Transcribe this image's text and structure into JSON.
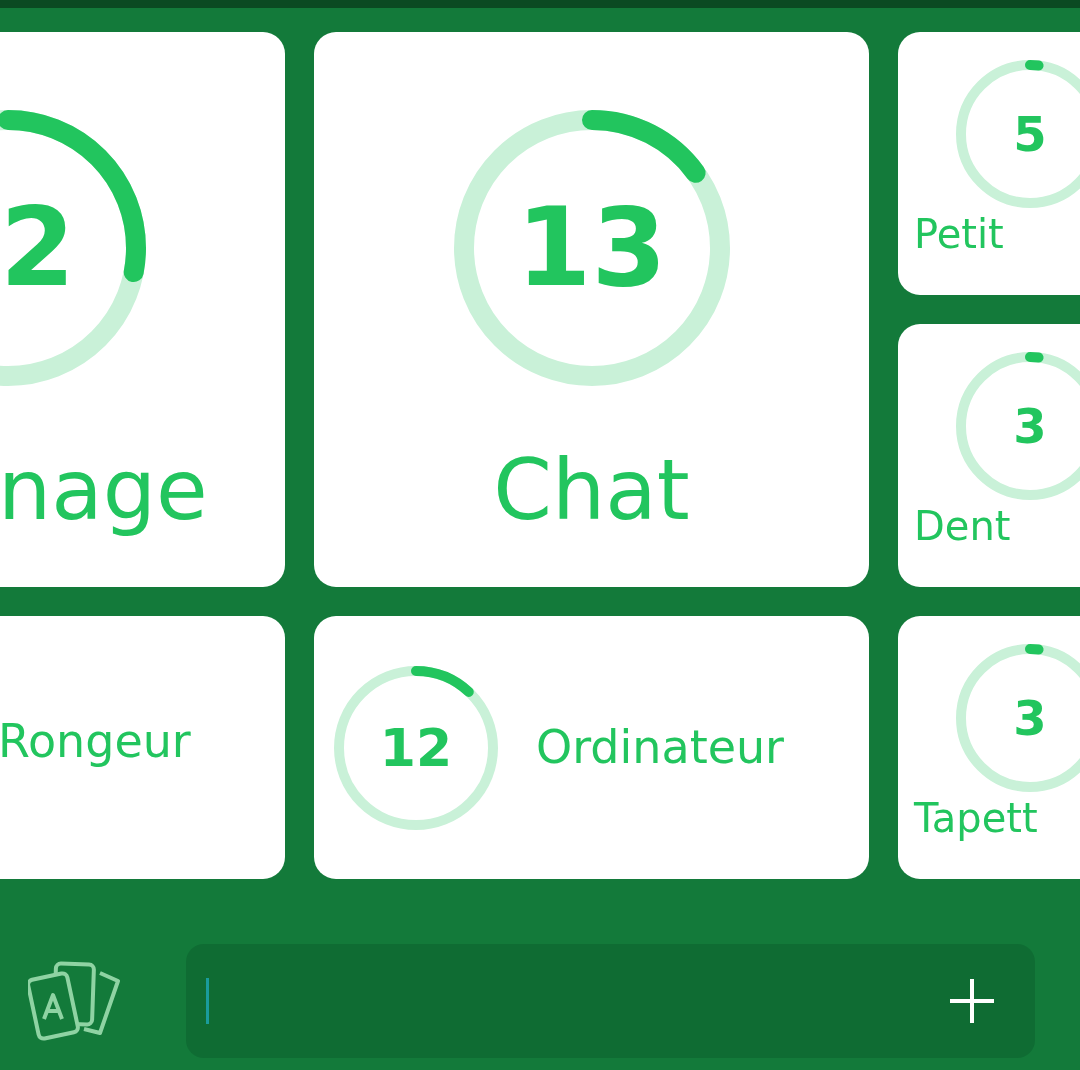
{
  "columns": [
    {
      "cards": [
        {
          "kind": "hero",
          "number": "2",
          "label": "nage"
        },
        {
          "kind": "row",
          "label": "Rongeur"
        }
      ]
    },
    {
      "cards": [
        {
          "kind": "hero",
          "number": "13",
          "label": "Chat"
        },
        {
          "kind": "row",
          "number": "12",
          "label": "Ordinateur"
        }
      ]
    },
    {
      "cards": [
        {
          "kind": "tile",
          "number": "5",
          "label": "Petit"
        },
        {
          "kind": "tile",
          "number": "3",
          "label": "Dent"
        },
        {
          "kind": "tile",
          "number": "3",
          "label": "Tapett"
        }
      ]
    }
  ],
  "input": {
    "focused": true
  }
}
